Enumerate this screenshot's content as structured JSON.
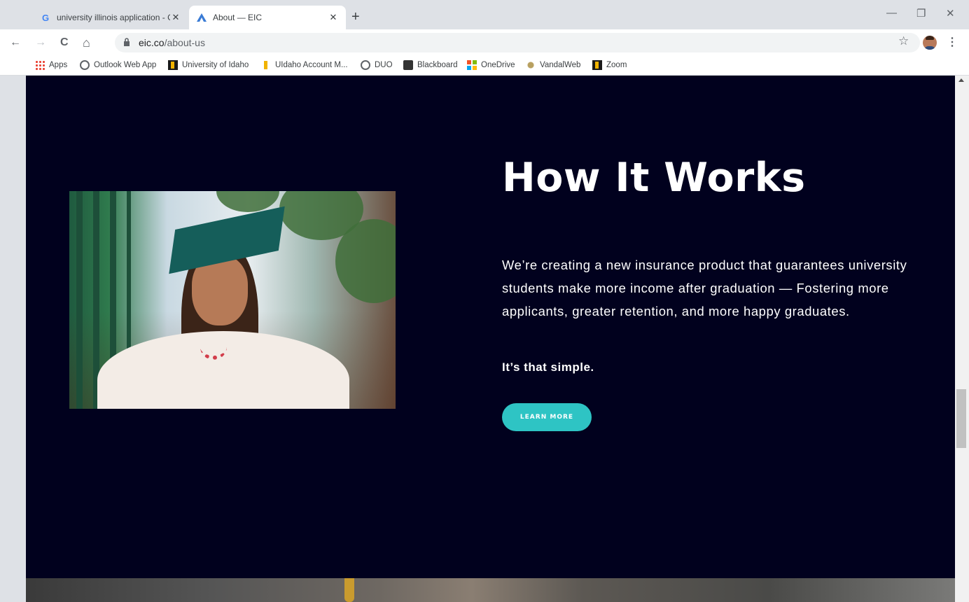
{
  "browser": {
    "tabs": [
      {
        "title": "university illinois application - Go",
        "favicon": "google-g-icon"
      },
      {
        "title": "About — EIC",
        "favicon": "eic-logo-icon",
        "active": true
      }
    ],
    "new_tab": "+",
    "window_controls": {
      "minimize": "—",
      "restore": "❐",
      "close": "✕"
    },
    "nav": {
      "back": "←",
      "forward": "→",
      "reload": "C",
      "home": "⌂"
    },
    "url": {
      "host": "eic.co",
      "path": "/about-us"
    },
    "bookmark_star": "☆",
    "menu": "⋮",
    "bookmarks": [
      {
        "label": "Apps",
        "icon": "apps-grid-icon"
      },
      {
        "label": "Outlook Web App",
        "icon": "globe-icon"
      },
      {
        "label": "University of Idaho",
        "icon": "uidaho-icon"
      },
      {
        "label": "UIdaho Account M...",
        "icon": "uidaho-icon"
      },
      {
        "label": "DUO",
        "icon": "globe-icon"
      },
      {
        "label": "Blackboard",
        "icon": "blackboard-icon"
      },
      {
        "label": "OneDrive",
        "icon": "microsoft-icon"
      },
      {
        "label": "VandalWeb",
        "icon": "vandalweb-icon"
      },
      {
        "label": "Zoom",
        "icon": "uidaho-icon"
      }
    ]
  },
  "hero": {
    "title": "How It Works",
    "body": "We’re creating a new insurance product that guarantees university students make more income after graduation — Fostering more applicants, greater retention, and more happy graduates.",
    "tagline": "It’s that simple.",
    "button_label": "LEARN MORE",
    "background_color": "#01011e",
    "button_color": "#2ec4c4"
  }
}
